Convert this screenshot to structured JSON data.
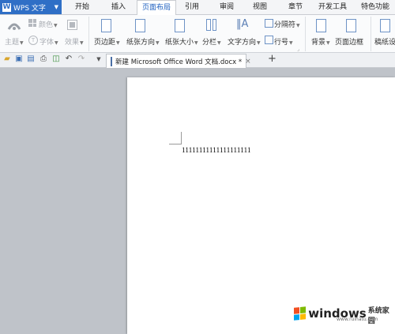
{
  "app": {
    "title": "WPS 文字"
  },
  "menu": {
    "tabs": [
      "开始",
      "插入",
      "页面布局",
      "引用",
      "审阅",
      "视图",
      "章节",
      "开发工具",
      "特色功能"
    ],
    "active": "页面布局"
  },
  "ribbon": {
    "theme": "主题",
    "color": "颜色",
    "font": "字体",
    "effect": "效果",
    "margins": "页边距",
    "orientation": "纸张方向",
    "size": "纸张大小",
    "columns": "分栏",
    "text_direction": "文字方向",
    "breaks": "分隔符",
    "line_numbers": "行号",
    "background": "背景",
    "page_border": "页面边框",
    "paper_setup": "稿纸设"
  },
  "doc_tab": {
    "title": "新建 Microsoft Office Word 文档.docx *",
    "close": "×",
    "new": "+"
  },
  "document": {
    "text": "11111111111111111111"
  },
  "watermark": {
    "main": "windows",
    "sub": "系统家园",
    "url": "www.ruihatu.com"
  },
  "colors": {
    "brand": "#2f6fc6",
    "active_tab_text": "#1d5fbf",
    "workspace": "#bfc3c9"
  }
}
